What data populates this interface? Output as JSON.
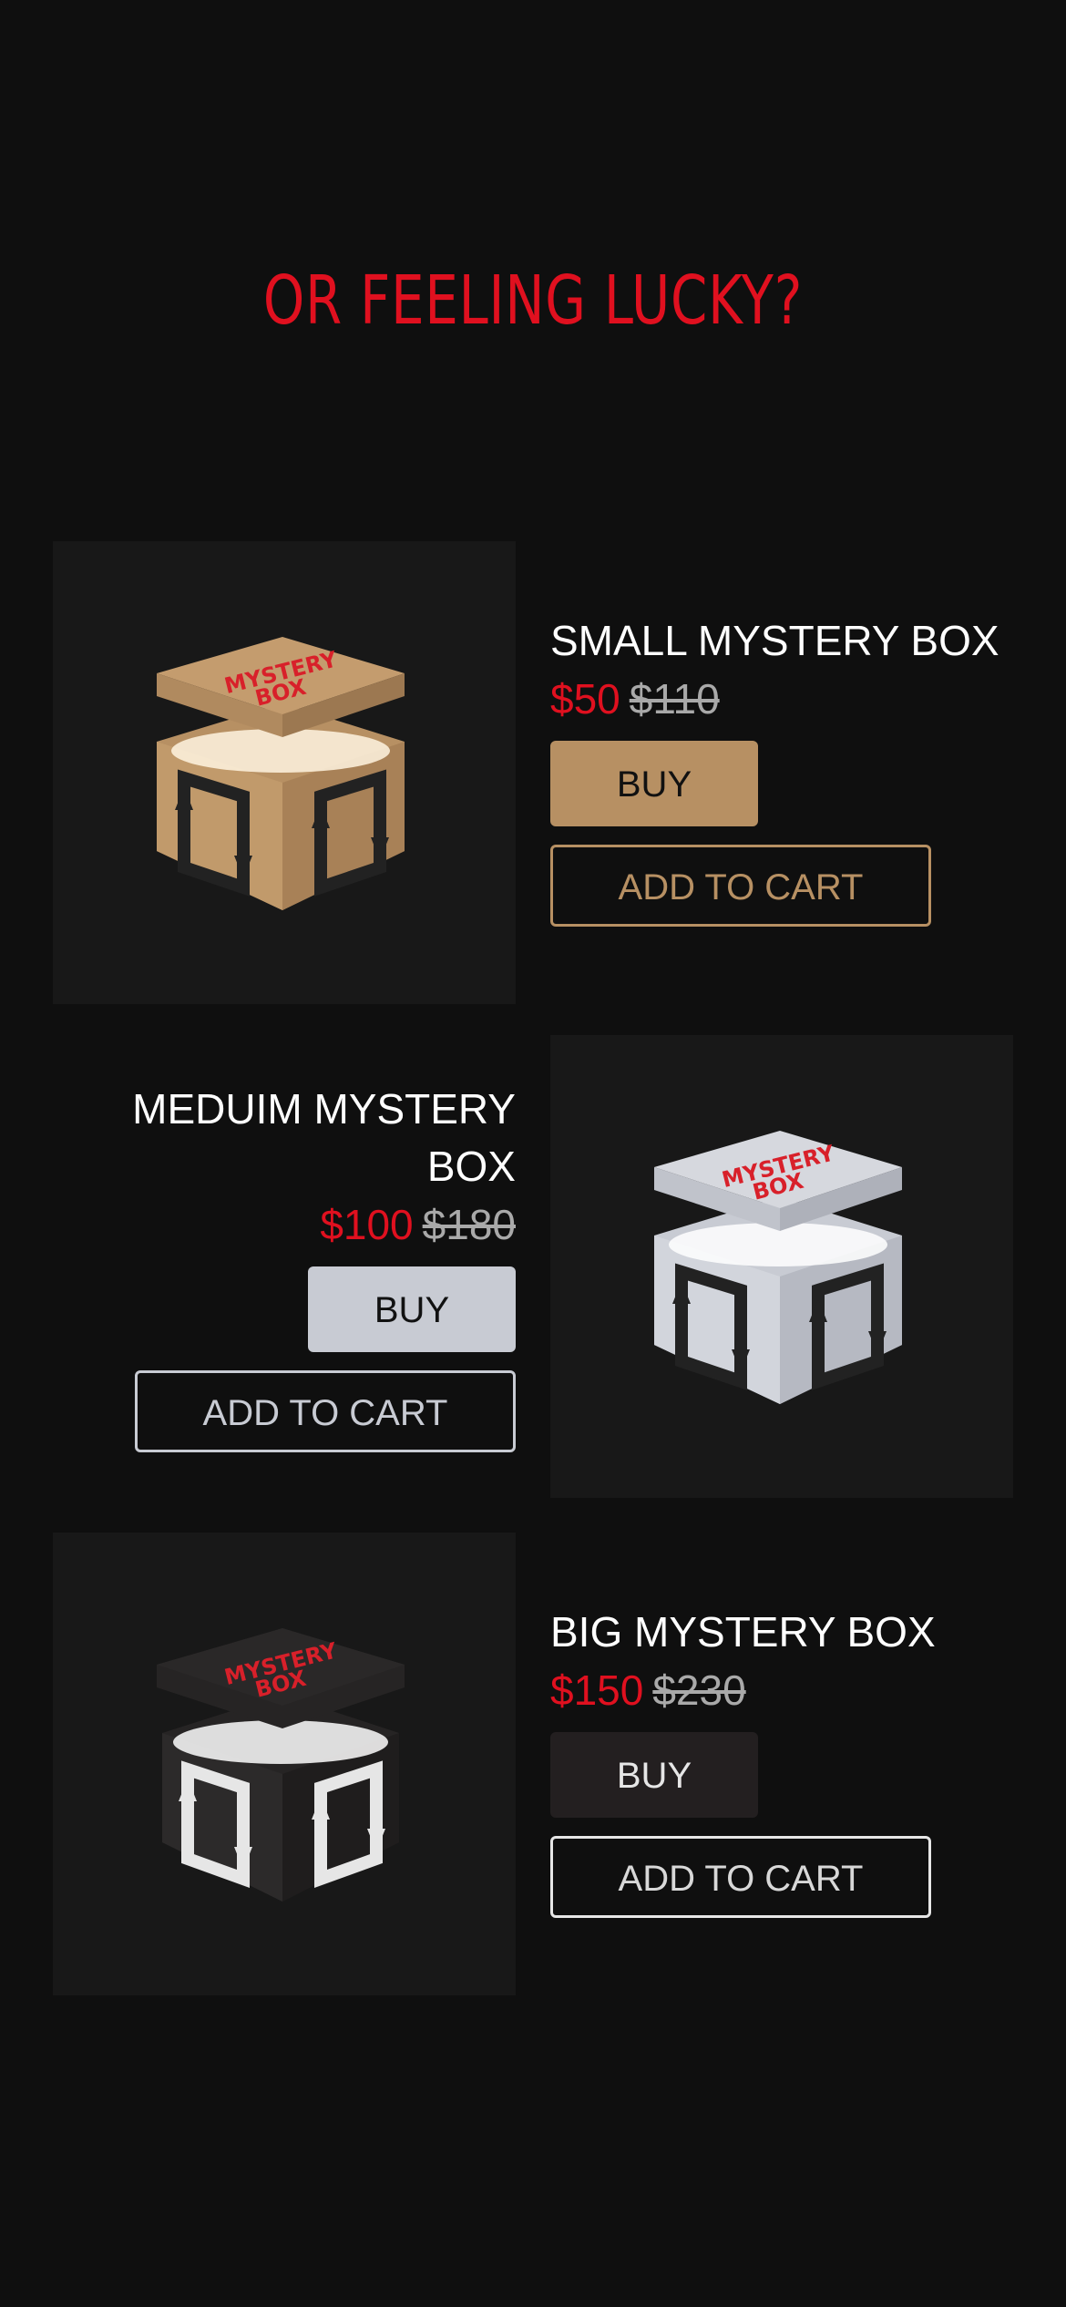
{
  "headline": "OR FEELING LUCKY?",
  "products": [
    {
      "title": "SMALL MYSTERY BOX",
      "price": "$50",
      "old_price": "$110",
      "buy_label": "BUY",
      "cart_label": "ADD TO CART",
      "box_logo_line1": "MYSTERY",
      "box_logo_line2": "BOX",
      "box_color": "#b79063",
      "accent_color": "#b79063"
    },
    {
      "title_line1": "MEDUIM MYSTERY",
      "title_line2": "BOX",
      "price": "$100",
      "old_price": "$180",
      "buy_label": "BUY",
      "cart_label": "ADD TO CART",
      "box_logo_line1": "MYSTERY",
      "box_logo_line2": "BOX",
      "box_color": "#c8cbd3",
      "accent_color": "#c8cbd3"
    },
    {
      "title": "BIG MYSTERY BOX",
      "price": "$150",
      "old_price": "$230",
      "buy_label": "BUY",
      "cart_label": "ADD TO CART",
      "box_logo_line1": "MYSTERY",
      "box_logo_line2": "BOX",
      "box_color": "#262424",
      "accent_color": "#e6e6e6"
    }
  ],
  "colors": {
    "background": "#0f0f0f",
    "card": "#181818",
    "price_red": "#e0101f",
    "old_price_gray": "#a9a9a9"
  }
}
